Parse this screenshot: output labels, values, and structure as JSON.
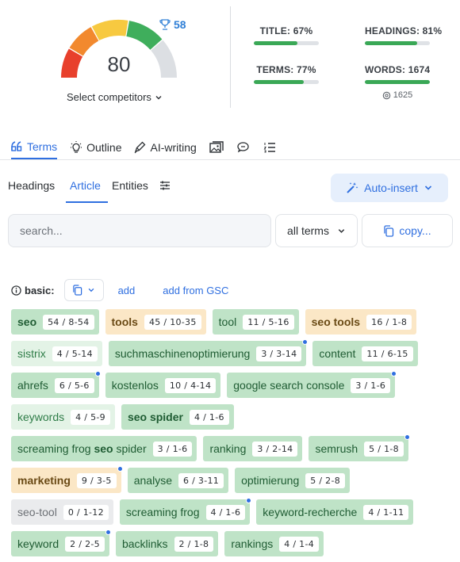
{
  "score": {
    "value": "80",
    "competitor_score": "58",
    "select_label": "Select competitors"
  },
  "metrics": {
    "title": {
      "label": "TITLE: 67%",
      "percent": 67
    },
    "headings": {
      "label": "HEADINGS: 81%",
      "percent": 81
    },
    "terms": {
      "label": "TERMS: 77%",
      "percent": 77
    },
    "words": {
      "label": "WORDS: 1674",
      "percent": 100,
      "target": "1625"
    }
  },
  "main_tabs": {
    "terms": "Terms",
    "outline": "Outline",
    "ai_writing": "AI-writing"
  },
  "sub_tabs": {
    "headings": "Headings",
    "article": "Article",
    "entities": "Entities"
  },
  "auto_insert": "Auto-insert",
  "search": {
    "placeholder": "search..."
  },
  "filter": {
    "selected": "all terms"
  },
  "copy_label": "copy...",
  "basic": {
    "label": "basic:",
    "add": "add",
    "add_gsc": "add from GSC"
  },
  "colors": {
    "accent": "#2f6fe0",
    "green_chip": "#bfe3c7",
    "light_green_chip": "#e3f3e6",
    "orange_chip": "#fbe7c6",
    "gray_chip": "#eaebed"
  },
  "terms": [
    [
      {
        "t": "seo",
        "c": "54",
        "r": "8-54",
        "s": "g-dark",
        "b": true
      },
      {
        "t": "tools",
        "c": "45",
        "r": "10-35",
        "s": "orange",
        "b": true
      },
      {
        "t": "tool",
        "c": "11",
        "r": "5-16",
        "s": "g-dark"
      },
      {
        "t": "seo tools",
        "c": "16",
        "r": "1-8",
        "s": "orange",
        "b": true
      }
    ],
    [
      {
        "t": "sistrix",
        "c": "4",
        "r": "5-14",
        "s": "g-light"
      },
      {
        "t": "suchmaschinenoptimierung",
        "c": "3",
        "r": "3-14",
        "s": "g-dark",
        "dot": true
      },
      {
        "t": "content",
        "c": "11",
        "r": "6-15",
        "s": "g-dark"
      }
    ],
    [
      {
        "t": "ahrefs",
        "c": "6",
        "r": "5-6",
        "s": "g-dark",
        "dot": true
      },
      {
        "t": "kostenlos",
        "c": "10",
        "r": "4-14",
        "s": "g-dark"
      },
      {
        "t": "google search console",
        "c": "3",
        "r": "1-6",
        "s": "g-dark",
        "dot": true
      }
    ],
    [
      {
        "t": "keywords",
        "c": "4",
        "r": "5-9",
        "s": "g-light"
      },
      {
        "t": "seo spider",
        "c": "4",
        "r": "1-6",
        "s": "g-dark",
        "b": true
      }
    ],
    [
      {
        "t": "screaming frog seo spider",
        "c": "3",
        "r": "1-6",
        "s": "g-dark",
        "bw": "seo"
      },
      {
        "t": "ranking",
        "c": "3",
        "r": "2-14",
        "s": "g-dark"
      },
      {
        "t": "semrush",
        "c": "5",
        "r": "1-8",
        "s": "g-dark",
        "dot": true
      }
    ],
    [
      {
        "t": "marketing",
        "c": "9",
        "r": "3-5",
        "s": "orange",
        "b": true,
        "dot": true
      },
      {
        "t": "analyse",
        "c": "6",
        "r": "3-11",
        "s": "g-dark"
      },
      {
        "t": "optimierung",
        "c": "5",
        "r": "2-8",
        "s": "g-dark"
      }
    ],
    [
      {
        "t": "seo-tool",
        "c": "0",
        "r": "1-12",
        "s": "gray"
      },
      {
        "t": "screaming frog",
        "c": "4",
        "r": "1-6",
        "s": "g-dark",
        "dot": true
      },
      {
        "t": "keyword-recherche",
        "c": "4",
        "r": "1-11",
        "s": "g-dark"
      }
    ],
    [
      {
        "t": "keyword",
        "c": "2",
        "r": "2-5",
        "s": "g-dark",
        "dot": true
      },
      {
        "t": "backlinks",
        "c": "2",
        "r": "1-8",
        "s": "g-dark"
      },
      {
        "t": "rankings",
        "c": "4",
        "r": "1-4",
        "s": "g-dark"
      }
    ]
  ]
}
